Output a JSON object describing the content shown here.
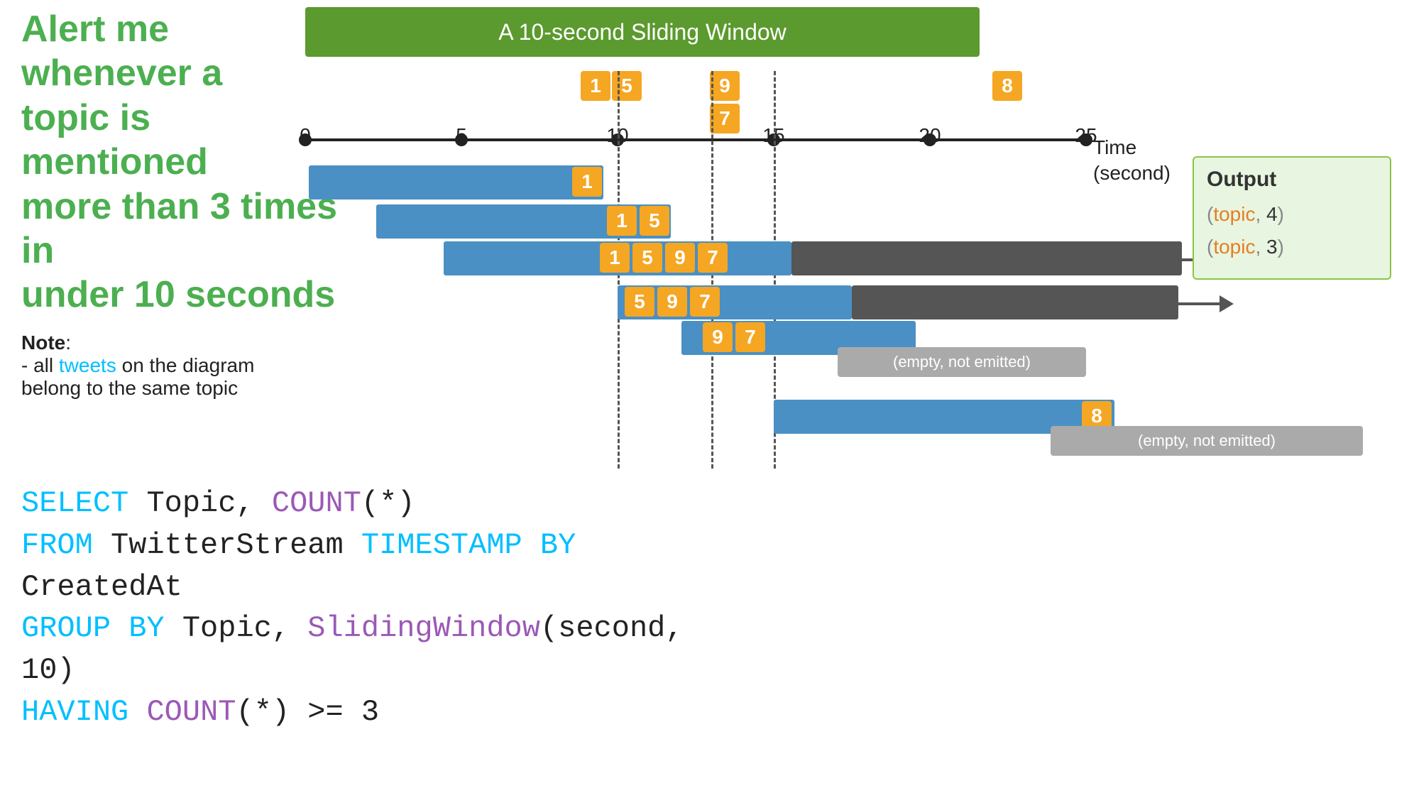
{
  "left": {
    "alert_line1": "Alert me whenever a",
    "alert_line2": "topic is mentioned",
    "alert_line3": "more than 3 times in",
    "alert_line4": "under 10 seconds",
    "note_label": "Note",
    "note_text1": "- all ",
    "tweets_word": "tweets",
    "note_text2": " on the diagram",
    "note_text3": "belong to the same topic"
  },
  "diagram": {
    "header": "A 10-second Sliding Window",
    "time_label_line1": "Time",
    "time_label_line2": "(second)",
    "ticks": [
      {
        "label": "0",
        "pos_pct": 0
      },
      {
        "label": "5",
        "pos_pct": 20
      },
      {
        "label": "10",
        "pos_pct": 40
      },
      {
        "label": "15",
        "pos_pct": 60
      },
      {
        "label": "20",
        "pos_pct": 80
      },
      {
        "label": "25",
        "pos_pct": 100
      }
    ],
    "badges_timeline": [
      {
        "value": "1",
        "time": 10
      },
      {
        "value": "5",
        "time": 11
      },
      {
        "value": "9",
        "time": 14
      },
      {
        "value": "7",
        "time": 15
      },
      {
        "value": "8",
        "time": 25
      }
    ],
    "bars": [
      {
        "start": 0,
        "width": 10,
        "badges": [
          "1"
        ],
        "label": "bar1"
      },
      {
        "start": 1,
        "width": 10,
        "badges": [
          "1",
          "5"
        ],
        "label": "bar2"
      },
      {
        "start": 2,
        "width": 10,
        "badges": [
          "1",
          "5",
          "9",
          "7"
        ],
        "label": "bar3",
        "has_arrow": true,
        "output": "(topic, 4)"
      },
      {
        "start": 5,
        "width": 10,
        "badges": [
          "5",
          "9",
          "7"
        ],
        "label": "bar4",
        "has_arrow": true,
        "output": "(topic, 3)"
      },
      {
        "start": 6,
        "width": 10,
        "badges": [
          "9",
          "7"
        ],
        "label": "bar5",
        "empty": true
      },
      {
        "start": 15,
        "width": 10,
        "badges": [
          "8"
        ],
        "label": "bar6",
        "empty2": true
      }
    ],
    "output_title": "Output",
    "output_items": [
      "(topic, 4)",
      "(topic, 3)"
    ],
    "empty_label": "(empty, not emitted)"
  },
  "sql": {
    "line1_kw1": "SELECT",
    "line1_rest": " Topic, ",
    "line1_kw2": "COUNT",
    "line1_rest2": "(*)",
    "line2_kw1": "FROM",
    "line2_rest1": " TwitterStream ",
    "line2_kw2": "TIMESTAMP BY",
    "line2_rest2": " CreatedAt",
    "line3_kw1": "GROUP BY",
    "line3_rest1": " Topic, ",
    "line3_kw2": "SlidingWindow",
    "line3_rest2": "(second, 10)",
    "line4_kw1": "HAVING",
    "line4_rest1": " ",
    "line4_kw2": "COUNT",
    "line4_rest2": "(*) >= 3"
  }
}
